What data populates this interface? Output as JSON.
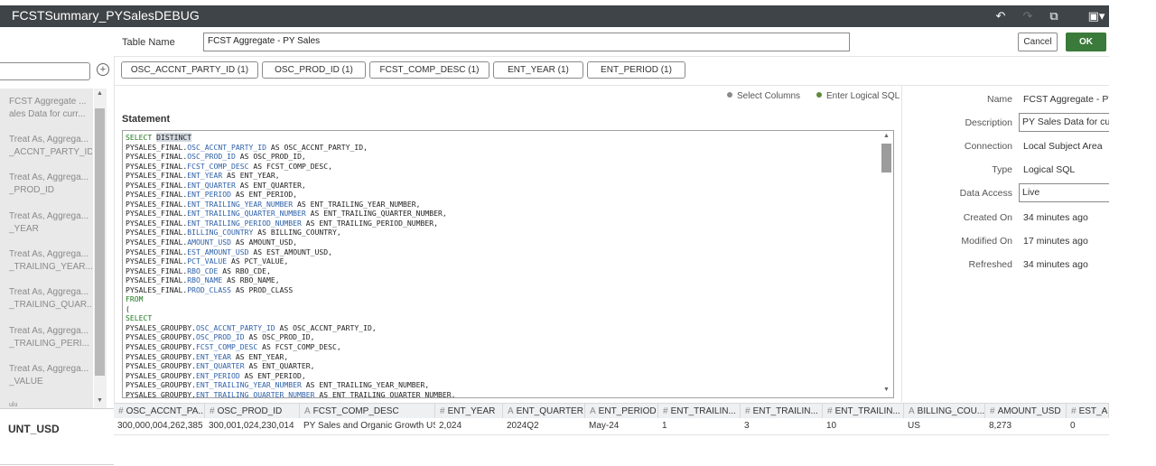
{
  "window": {
    "title": "FCSTSummary_PYSalesDEBUG"
  },
  "toolbar": {
    "undo_icon": "undo-icon",
    "redo_icon": "redo-icon",
    "edit_icon": "edit-icon",
    "save_icon": "save-icon",
    "undo_glyph": "↶",
    "redo_glyph": "↷",
    "edit_glyph": "⧉",
    "save_glyph": "▣▾"
  },
  "header": {
    "table_name_label": "Table Name",
    "table_name_value": "FCST Aggregate - PY Sales",
    "cancel_label": "Cancel",
    "ok_label": "OK"
  },
  "sidebar": {
    "add_glyph": "+",
    "items": [
      "FCST Aggregate ...",
      "ales Data for curr...",
      "Treat As, Aggrega...",
      "_ACCNT_PARTY_ID",
      "Treat As, Aggrega...",
      "_PROD_ID",
      "Treat As, Aggrega...",
      "_YEAR",
      "Treat As, Aggrega...",
      "_TRAILING_YEAR...",
      "Treat As, Aggrega...",
      "_TRAILING_QUAR...",
      "Treat As, Aggrega...",
      "_TRAILING_PERI...",
      "Treat As, Aggrega...",
      "_VALUE",
      "ulu"
    ],
    "bottom_label": "UNT_USD"
  },
  "key_chips": [
    "OSC_ACCNT_PARTY_ID (1)",
    "OSC_PROD_ID (1)",
    "FCST_COMP_DESC (1)",
    "ENT_YEAR (1)",
    "ENT_PERIOD (1)"
  ],
  "mode_options": {
    "select_columns": "Select Columns",
    "enter_logical_sql": "Enter Logical SQL",
    "selected": "Enter Logical SQL"
  },
  "statement": {
    "label": "Statement",
    "lines": [
      [
        [
          "kw",
          "SELECT "
        ],
        [
          "sel",
          "DISTINCT"
        ]
      ],
      [
        [
          "t",
          "PYSALES_FINAL."
        ],
        [
          "fld",
          "OSC_ACCNT_PARTY_ID"
        ],
        [
          "t",
          " AS OSC_ACCNT_PARTY_ID,"
        ]
      ],
      [
        [
          "t",
          "PYSALES_FINAL."
        ],
        [
          "fld",
          "OSC_PROD_ID"
        ],
        [
          "t",
          " AS OSC_PROD_ID,"
        ]
      ],
      [
        [
          "t",
          "PYSALES_FINAL."
        ],
        [
          "fld",
          "FCST_COMP_DESC"
        ],
        [
          "t",
          " AS FCST_COMP_DESC,"
        ]
      ],
      [
        [
          "t",
          "PYSALES_FINAL."
        ],
        [
          "fld",
          "ENT_YEAR"
        ],
        [
          "t",
          " AS ENT_YEAR,"
        ]
      ],
      [
        [
          "t",
          "PYSALES_FINAL."
        ],
        [
          "fld",
          "ENT_QUARTER"
        ],
        [
          "t",
          " AS ENT_QUARTER,"
        ]
      ],
      [
        [
          "t",
          "PYSALES_FINAL."
        ],
        [
          "fld",
          "ENT_PERIOD"
        ],
        [
          "t",
          " AS ENT_PERIOD,"
        ]
      ],
      [
        [
          "t",
          "PYSALES_FINAL."
        ],
        [
          "fld",
          "ENT_TRAILING_YEAR_NUMBER"
        ],
        [
          "t",
          " AS ENT_TRAILING_YEAR_NUMBER,"
        ]
      ],
      [
        [
          "t",
          "PYSALES_FINAL."
        ],
        [
          "fld",
          "ENT_TRAILING_QUARTER_NUMBER"
        ],
        [
          "t",
          " AS ENT_TRAILING_QUARTER_NUMBER,"
        ]
      ],
      [
        [
          "t",
          "PYSALES_FINAL."
        ],
        [
          "fld",
          "ENT_TRAILING_PERIOD_NUMBER"
        ],
        [
          "t",
          " AS ENT_TRAILING_PERIOD_NUMBER,"
        ]
      ],
      [
        [
          "t",
          "PYSALES_FINAL."
        ],
        [
          "fld",
          "BILLING_COUNTRY"
        ],
        [
          "t",
          " AS BILLING_COUNTRY,"
        ]
      ],
      [
        [
          "t",
          "PYSALES_FINAL."
        ],
        [
          "fld",
          "AMOUNT_USD"
        ],
        [
          "t",
          " AS AMOUNT_USD,"
        ]
      ],
      [
        [
          "t",
          "PYSALES_FINAL."
        ],
        [
          "fld",
          "EST_AMOUNT_USD"
        ],
        [
          "t",
          " AS EST_AMOUNT_USD,"
        ]
      ],
      [
        [
          "t",
          "PYSALES_FINAL."
        ],
        [
          "fld",
          "PCT_VALUE"
        ],
        [
          "t",
          " AS PCT_VALUE,"
        ]
      ],
      [
        [
          "t",
          "PYSALES_FINAL."
        ],
        [
          "fld",
          "RBO_CDE"
        ],
        [
          "t",
          " AS RBO_CDE,"
        ]
      ],
      [
        [
          "t",
          "PYSALES_FINAL."
        ],
        [
          "fld",
          "RBO_NAME"
        ],
        [
          "t",
          " AS RBO_NAME,"
        ]
      ],
      [
        [
          "t",
          "PYSALES_FINAL."
        ],
        [
          "fld",
          "PROD_CLASS"
        ],
        [
          "t",
          " AS PROD_CLASS"
        ]
      ],
      [
        [
          "kw",
          "FROM"
        ]
      ],
      [
        [
          "t",
          "("
        ]
      ],
      [
        [
          "kw",
          "SELECT"
        ]
      ],
      [
        [
          "t",
          "PYSALES_GROUPBY."
        ],
        [
          "fld",
          "OSC_ACCNT_PARTY_ID"
        ],
        [
          "t",
          " AS OSC_ACCNT_PARTY_ID,"
        ]
      ],
      [
        [
          "t",
          "PYSALES_GROUPBY."
        ],
        [
          "fld",
          "OSC_PROD_ID"
        ],
        [
          "t",
          " AS OSC_PROD_ID,"
        ]
      ],
      [
        [
          "t",
          "PYSALES_GROUPBY."
        ],
        [
          "fld",
          "FCST_COMP_DESC"
        ],
        [
          "t",
          " AS FCST_COMP_DESC,"
        ]
      ],
      [
        [
          "t",
          "PYSALES_GROUPBY."
        ],
        [
          "fld",
          "ENT_YEAR"
        ],
        [
          "t",
          " AS ENT_YEAR,"
        ]
      ],
      [
        [
          "t",
          "PYSALES_GROUPBY."
        ],
        [
          "fld",
          "ENT_QUARTER"
        ],
        [
          "t",
          " AS ENT_QUARTER,"
        ]
      ],
      [
        [
          "t",
          "PYSALES_GROUPBY."
        ],
        [
          "fld",
          "ENT_PERIOD"
        ],
        [
          "t",
          " AS ENT_PERIOD,"
        ]
      ],
      [
        [
          "t",
          "PYSALES_GROUPBY."
        ],
        [
          "fld",
          "ENT_TRAILING_YEAR_NUMBER"
        ],
        [
          "t",
          " AS ENT_TRAILING_YEAR_NUMBER,"
        ]
      ],
      [
        [
          "t",
          "PYSALES_GROUPBY."
        ],
        [
          "fld",
          "ENT_TRAILING_QUARTER_NUMBER"
        ],
        [
          "t",
          " AS ENT_TRAILING_QUARTER_NUMBER,"
        ]
      ]
    ]
  },
  "properties": {
    "name_label": "Name",
    "name_value": "FCST Aggregate - PY",
    "description_label": "Description",
    "description_value": "PY Sales Data for curr",
    "connection_label": "Connection",
    "connection_value": "Local Subject Area",
    "type_label": "Type",
    "type_value": "Logical SQL",
    "data_access_label": "Data Access",
    "data_access_value": "Live",
    "created_label": "Created On",
    "created_value": "34 minutes ago",
    "modified_label": "Modified On",
    "modified_value": "17 minutes ago",
    "refreshed_label": "Refreshed",
    "refreshed_value": "34 minutes ago"
  },
  "results": {
    "columns": [
      {
        "type": "#",
        "name": "OSC_ACCNT_PA..."
      },
      {
        "type": "#",
        "name": "OSC_PROD_ID"
      },
      {
        "type": "A",
        "name": "FCST_COMP_DESC"
      },
      {
        "type": "#",
        "name": "ENT_YEAR"
      },
      {
        "type": "A",
        "name": "ENT_QUARTER"
      },
      {
        "type": "A",
        "name": "ENT_PERIOD"
      },
      {
        "type": "#",
        "name": "ENT_TRAILIN..."
      },
      {
        "type": "#",
        "name": "ENT_TRAILIN..."
      },
      {
        "type": "#",
        "name": "ENT_TRAILIN..."
      },
      {
        "type": "A",
        "name": "BILLING_COU..."
      },
      {
        "type": "#",
        "name": "AMOUNT_USD"
      },
      {
        "type": "#",
        "name": "EST_A"
      }
    ],
    "rows": [
      [
        "300,000,004,262,385",
        "300,001,024,230,014",
        "PY Sales and Organic Growth USD",
        "2,024",
        "2024Q2",
        "May-24",
        "1",
        "3",
        "10",
        "US",
        "8,273",
        "0"
      ]
    ]
  }
}
